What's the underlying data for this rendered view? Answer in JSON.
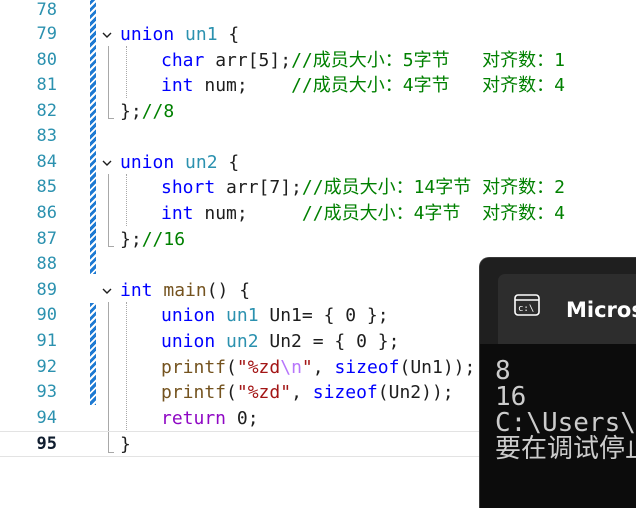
{
  "editor": {
    "current_line": "95",
    "lines": [
      {
        "n": "78",
        "text": ""
      },
      {
        "n": "79",
        "text": "union un1 {"
      },
      {
        "n": "80",
        "text": "char arr[5];//成员大小：5字节   对齐数：1"
      },
      {
        "n": "81",
        "text": "int num;    //成员大小：4字节   对齐数：4"
      },
      {
        "n": "82",
        "text": "};//8"
      },
      {
        "n": "83",
        "text": ""
      },
      {
        "n": "84",
        "text": "union un2 {"
      },
      {
        "n": "85",
        "text": "short arr[7];//成员大小：14字节 对齐数：2"
      },
      {
        "n": "86",
        "text": "int num;     //成员大小：4字节  对齐数：4"
      },
      {
        "n": "87",
        "text": "};//16"
      },
      {
        "n": "88",
        "text": ""
      },
      {
        "n": "89",
        "text": "int main() {"
      },
      {
        "n": "90",
        "text": "union un1 Un1= { 0 };"
      },
      {
        "n": "91",
        "text": "union un2 Un2 = { 0 };"
      },
      {
        "n": "92",
        "text": "printf(\"%zd\\n\", sizeof(Un1));"
      },
      {
        "n": "93",
        "text": "printf(\"%zd\", sizeof(Un2));"
      },
      {
        "n": "94",
        "text": "return 0;"
      },
      {
        "n": "95",
        "text": "}"
      }
    ],
    "tokens": {
      "l79": {
        "kw": "union",
        "name": "un1",
        "rest": " {"
      },
      "l80": {
        "type": "char",
        "code": " arr[5];",
        "comment": "//成员大小：5字节   对齐数：1"
      },
      "l81": {
        "type": "int",
        "code": " num;    ",
        "comment": "//成员大小：4字节   对齐数：4"
      },
      "l82": {
        "code": "};",
        "comment": "//8"
      },
      "l84": {
        "kw": "union",
        "name": "un2",
        "rest": " {"
      },
      "l85": {
        "type": "short",
        "code": " arr[7];",
        "comment": "//成员大小：14字节 对齐数：2"
      },
      "l86": {
        "type": "int",
        "code": " num;     ",
        "comment": "//成员大小：4字节  对齐数：4"
      },
      "l87": {
        "code": "};",
        "comment": "//16"
      },
      "l89": {
        "type": "int",
        "fn": "main",
        "rest": "() {"
      },
      "l90": {
        "kw": "union",
        "name": "un1",
        "rest": " Un1= { 0 };"
      },
      "l91": {
        "kw": "union",
        "name": "un2",
        "rest": " Un2 = { 0 };"
      },
      "l92": {
        "fn": "printf",
        "open": "(",
        "str1": "\"%zd",
        "esc": "\\n",
        "str2": "\"",
        "mid": ", ",
        "fn2": "sizeof",
        "rest": "(Un1));"
      },
      "l93": {
        "fn": "printf",
        "open": "(",
        "str1": "\"%zd\"",
        "mid": ", ",
        "fn2": "sizeof",
        "rest": "(Un2));"
      },
      "l94": {
        "kw": "return",
        "rest": " 0;"
      },
      "l95": {
        "code": "}"
      }
    }
  },
  "terminal": {
    "title": "Microsoft Visual Studio 调试控制台",
    "icon": "terminal-icon",
    "output": [
      "8",
      "16",
      "C:\\Users\\",
      "要在调试停止时自动关闭控制台"
    ]
  },
  "colors": {
    "keyword": "#0000ff",
    "control_keyword": "#8f08c4",
    "type_name": "#2b91af",
    "comment": "#008000",
    "function": "#74531f",
    "string": "#a31515",
    "change_marker": "#1e7ad2",
    "terminal_bg": "#0c0c0c"
  }
}
